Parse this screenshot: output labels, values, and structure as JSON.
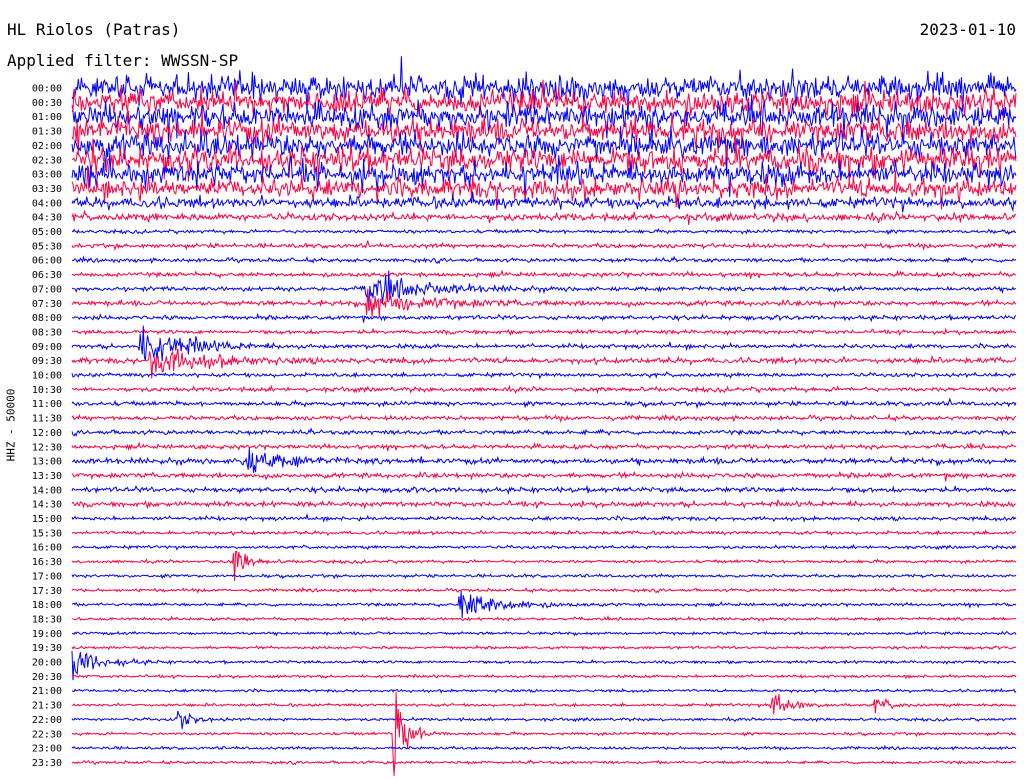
{
  "header": {
    "station_title": "HL Riolos (Patras)",
    "date": "2023-01-10",
    "filter_label": "Applied filter: WWSSN-SP"
  },
  "chart_data": {
    "type": "line",
    "title": "HL Riolos (Patras)",
    "ylabel": "HHZ - 50000",
    "row_labels": [
      "00:00",
      "00:30",
      "01:00",
      "01:30",
      "02:00",
      "02:30",
      "03:00",
      "03:30",
      "04:00",
      "04:30",
      "05:00",
      "05:30",
      "06:00",
      "06:30",
      "07:00",
      "07:30",
      "08:00",
      "08:30",
      "09:00",
      "09:30",
      "10:00",
      "10:30",
      "11:00",
      "11:30",
      "12:00",
      "12:30",
      "13:00",
      "13:30",
      "14:00",
      "14:30",
      "15:00",
      "15:30",
      "16:00",
      "16:30",
      "17:00",
      "17:30",
      "18:00",
      "18:30",
      "19:00",
      "19:30",
      "20:00",
      "20:30",
      "21:00",
      "21:30",
      "22:00",
      "22:30",
      "23:00",
      "23:30"
    ],
    "colors": [
      "#0000ff",
      "#ff0040"
    ],
    "row_activity": [
      1.0,
      1.0,
      1.0,
      1.0,
      1.0,
      1.0,
      0.9,
      0.8,
      0.4,
      0.25,
      0.08,
      0.12,
      0.1,
      0.12,
      0.12,
      0.15,
      0.12,
      0.1,
      0.12,
      0.18,
      0.1,
      0.12,
      0.12,
      0.12,
      0.12,
      0.12,
      0.18,
      0.15,
      0.15,
      0.15,
      0.1,
      0.08,
      0.06,
      0.06,
      0.06,
      0.06,
      0.06,
      0.06,
      0.05,
      0.05,
      0.05,
      0.05,
      0.05,
      0.05,
      0.05,
      0.05,
      0.05,
      0.05
    ],
    "events": [
      {
        "row": 14,
        "time_frac": 0.31,
        "amplitude": 1.3,
        "duration": 0.08
      },
      {
        "row": 15,
        "time_frac": 0.31,
        "amplitude": 1.0,
        "duration": 0.09
      },
      {
        "row": 18,
        "time_frac": 0.07,
        "amplitude": 1.6,
        "duration": 0.07
      },
      {
        "row": 19,
        "time_frac": 0.08,
        "amplitude": 1.2,
        "duration": 0.08
      },
      {
        "row": 26,
        "time_frac": 0.18,
        "amplitude": 1.0,
        "duration": 0.06
      },
      {
        "row": 33,
        "time_frac": 0.17,
        "amplitude": 1.4,
        "duration": 0.02
      },
      {
        "row": 36,
        "time_frac": 0.41,
        "amplitude": 1.2,
        "duration": 0.06
      },
      {
        "row": 40,
        "time_frac": 0.0,
        "amplitude": 1.3,
        "duration": 0.04
      },
      {
        "row": 43,
        "time_frac": 0.74,
        "amplitude": 1.1,
        "duration": 0.03
      },
      {
        "row": 43,
        "time_frac": 0.85,
        "amplitude": 0.6,
        "duration": 0.02
      },
      {
        "row": 44,
        "time_frac": 0.11,
        "amplitude": 1.1,
        "duration": 0.02
      },
      {
        "row": 45,
        "time_frac": 0.34,
        "amplitude": 3.8,
        "duration": 0.02
      }
    ]
  }
}
